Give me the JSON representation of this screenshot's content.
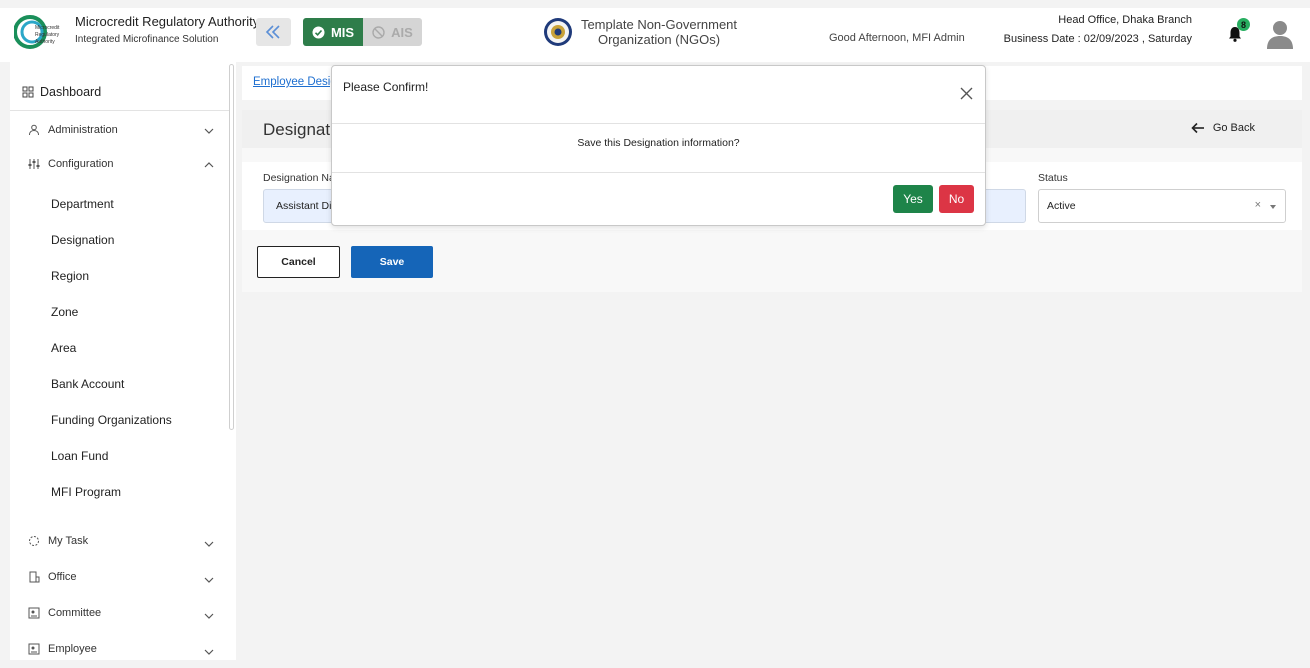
{
  "header": {
    "logo_text": [
      "Microcredit",
      "Regulatory",
      "Authority"
    ],
    "brand_title": "Microcredit Regulatory Authority",
    "brand_subtitle": "Integrated Microfinance Solution",
    "mis_label": "MIS",
    "ais_label": "AIS",
    "org_line1": "Template Non-Government",
    "org_line2": "Organization (NGOs)",
    "greeting": "Good Afternoon, MFI Admin",
    "branch": "Head Office, Dhaka Branch",
    "business_date": "Business Date : 02/09/2023 , Saturday",
    "notification_count": "8"
  },
  "sidebar": {
    "dashboard": "Dashboard",
    "items": [
      {
        "label": "Administration"
      },
      {
        "label": "Configuration"
      }
    ],
    "config_sub": [
      "Department",
      "Designation",
      "Region",
      "Zone",
      "Area",
      "Bank Account",
      "Funding Organizations",
      "Loan Fund",
      "MFI Program"
    ],
    "bottom_items": [
      {
        "label": "My Task"
      },
      {
        "label": "Office"
      },
      {
        "label": "Committee"
      },
      {
        "label": "Employee"
      }
    ]
  },
  "main": {
    "breadcrumb": "Employee Desig",
    "title": "Designat",
    "go_back": "Go Back",
    "name_label": "Designation Na",
    "name_value": "Assistant Di",
    "status_label": "Status",
    "status_value": "Active",
    "cancel_label": "Cancel",
    "save_label": "Save"
  },
  "modal": {
    "title": "Please Confirm!",
    "message": "Save this Designation information?",
    "yes_label": "Yes",
    "no_label": "No"
  },
  "colors": {
    "mis_green": "#2e7d4a",
    "save_blue": "#1565b8",
    "yes_green": "#1e8449",
    "no_red": "#dc3545",
    "link_blue": "#1e6fd0"
  }
}
